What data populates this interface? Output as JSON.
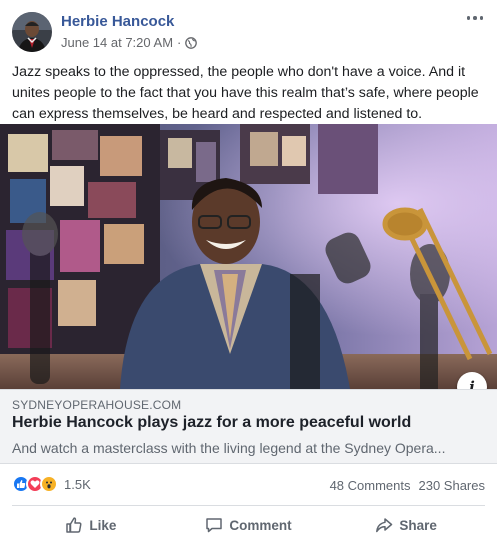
{
  "post": {
    "author": "Herbie Hancock",
    "timestamp": "June 14 at 7:20 AM",
    "separator": "·",
    "privacy_icon": "globe-icon",
    "text": "Jazz speaks to the oppressed, the people who don't have a voice. And it unites people to the fact that you have this realm that’s safe, where people can express themselves, be heard and respected and listened to."
  },
  "media": {
    "info_label": "i"
  },
  "link": {
    "domain": "SYDNEYOPERAHOUSE.COM",
    "title": "Herbie Hancock plays jazz for a more peaceful world",
    "description": "And watch a masterclass with the living legend at the Sydney Opera..."
  },
  "engagement": {
    "reaction_icons": [
      "like-icon",
      "love-icon",
      "wow-icon"
    ],
    "reaction_count": "1.5K",
    "comments": "48 Comments",
    "shares": "230 Shares"
  },
  "actions": {
    "like": "Like",
    "comment": "Comment",
    "share": "Share"
  },
  "colors": {
    "author_link": "#385898",
    "like": "#1877f2",
    "love": "#f33e58",
    "wow": "#f7b125",
    "secondary_text": "#606770"
  }
}
